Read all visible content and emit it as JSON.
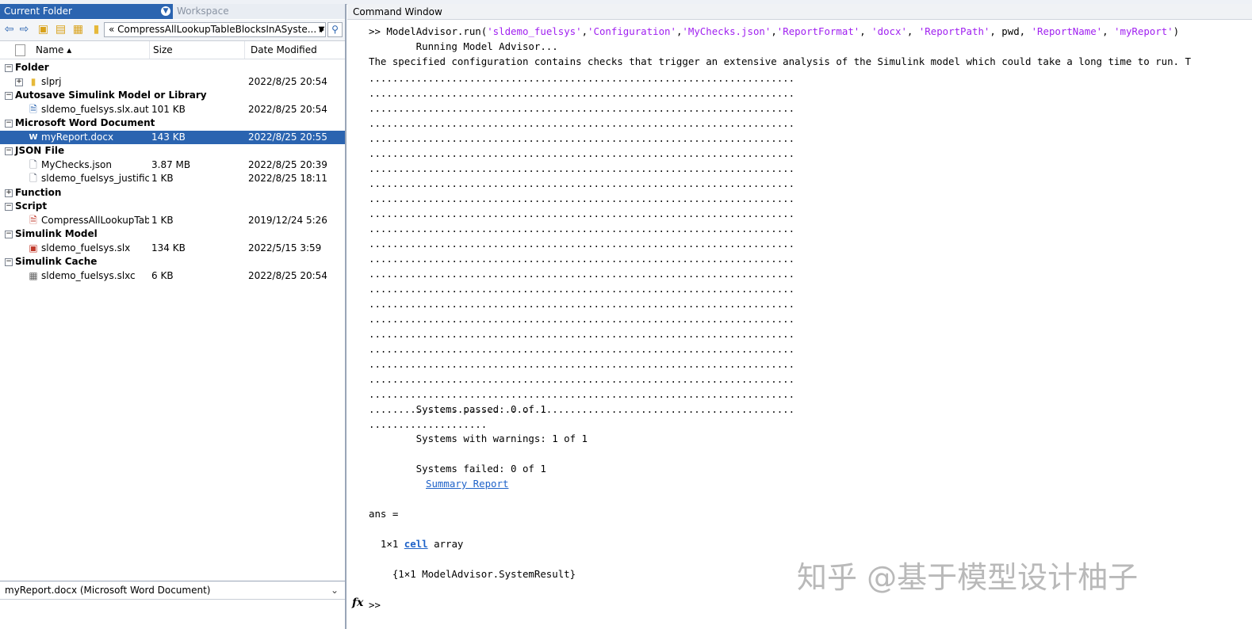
{
  "left_panel": {
    "tab_current_folder": "Current Folder",
    "tab_workspace": "Workspace",
    "path": "« CompressAllLookupTableBlocksInASyste... ▸",
    "columns": {
      "name": "Name ▴",
      "size": "Size",
      "date": "Date Modified"
    },
    "groups": [
      {
        "label": "Folder",
        "expanded": true,
        "items": [
          {
            "name": "slprj",
            "size": "",
            "date": "2022/8/25 20:54",
            "icon": "folder-icon",
            "expandable": true
          }
        ]
      },
      {
        "label": "Autosave Simulink Model or Library",
        "expanded": true,
        "items": [
          {
            "name": "sldemo_fuelsys.slx.autosa...",
            "size": "101 KB",
            "date": "2022/8/25 20:54",
            "icon": "autosave-file-icon"
          }
        ]
      },
      {
        "label": "Microsoft Word Document",
        "expanded": true,
        "items": [
          {
            "name": "myReport.docx",
            "size": "143 KB",
            "date": "2022/8/25 20:55",
            "icon": "word-document-icon",
            "selected": true
          }
        ]
      },
      {
        "label": "JSON File",
        "expanded": true,
        "items": [
          {
            "name": "MyChecks.json",
            "size": "3.87 MB",
            "date": "2022/8/25 20:39",
            "icon": "json-file-icon"
          },
          {
            "name": "sldemo_fuelsys_justificati...",
            "size": "1 KB",
            "date": "2022/8/25 18:11",
            "icon": "json-file-icon"
          }
        ]
      },
      {
        "label": "Function",
        "expanded": false,
        "items": []
      },
      {
        "label": "Script",
        "expanded": true,
        "items": [
          {
            "name": "CompressAllLookupTabl...",
            "size": "1 KB",
            "date": "2019/12/24 5:26",
            "icon": "script-file-icon"
          }
        ]
      },
      {
        "label": "Simulink Model",
        "expanded": true,
        "items": [
          {
            "name": "sldemo_fuelsys.slx",
            "size": "134 KB",
            "date": "2022/5/15 3:59",
            "icon": "simulink-model-icon"
          }
        ]
      },
      {
        "label": "Simulink Cache",
        "expanded": true,
        "items": [
          {
            "name": "sldemo_fuelsys.slxc",
            "size": "6 KB",
            "date": "2022/8/25 20:54",
            "icon": "simulink-cache-icon"
          }
        ]
      }
    ],
    "details": "myReport.docx  (Microsoft Word Document)"
  },
  "command_window": {
    "title": "Command Window",
    "command": {
      "prompt": ">> ",
      "segments": [
        {
          "t": "ModelAdvisor.run(",
          "s": false
        },
        {
          "t": "'sldemo_fuelsys'",
          "s": true
        },
        {
          "t": ",",
          "s": false
        },
        {
          "t": "'Configuration'",
          "s": true
        },
        {
          "t": ",",
          "s": false
        },
        {
          "t": "'MyChecks.json'",
          "s": true
        },
        {
          "t": ",",
          "s": false
        },
        {
          "t": "'ReportFormat'",
          "s": true
        },
        {
          "t": ", ",
          "s": false
        },
        {
          "t": "'docx'",
          "s": true
        },
        {
          "t": ", ",
          "s": false
        },
        {
          "t": "'ReportPath'",
          "s": true
        },
        {
          "t": ", pwd, ",
          "s": false
        },
        {
          "t": "'ReportName'",
          "s": true
        },
        {
          "t": ", ",
          "s": false
        },
        {
          "t": "'myReport'",
          "s": true
        },
        {
          "t": ")",
          "s": false
        }
      ]
    },
    "running": "        Running Model Advisor...",
    "warning": "The specified configuration contains checks that trigger an extensive analysis of the Simulink model which could take a long time to run. T",
    "dots_full": "........................................................................",
    "dots_full_count": 23,
    "dots_last": "....................",
    "systems_passed": "        Systems passed: 0 of 1",
    "systems_warnings": "        Systems with warnings: 1 of 1",
    "systems_failed": "        Systems failed: 0 of 1",
    "summary_link": "Summary Report",
    "ans": "ans =",
    "cell_prefix": "  1×1 ",
    "cell_kw": "cell",
    "cell_suffix": " array",
    "result": "    {1×1 ModelAdvisor.SystemResult}",
    "fx_label": "fx",
    "prompt": ">>"
  },
  "watermark": "知乎 @基于模型设计柚子"
}
